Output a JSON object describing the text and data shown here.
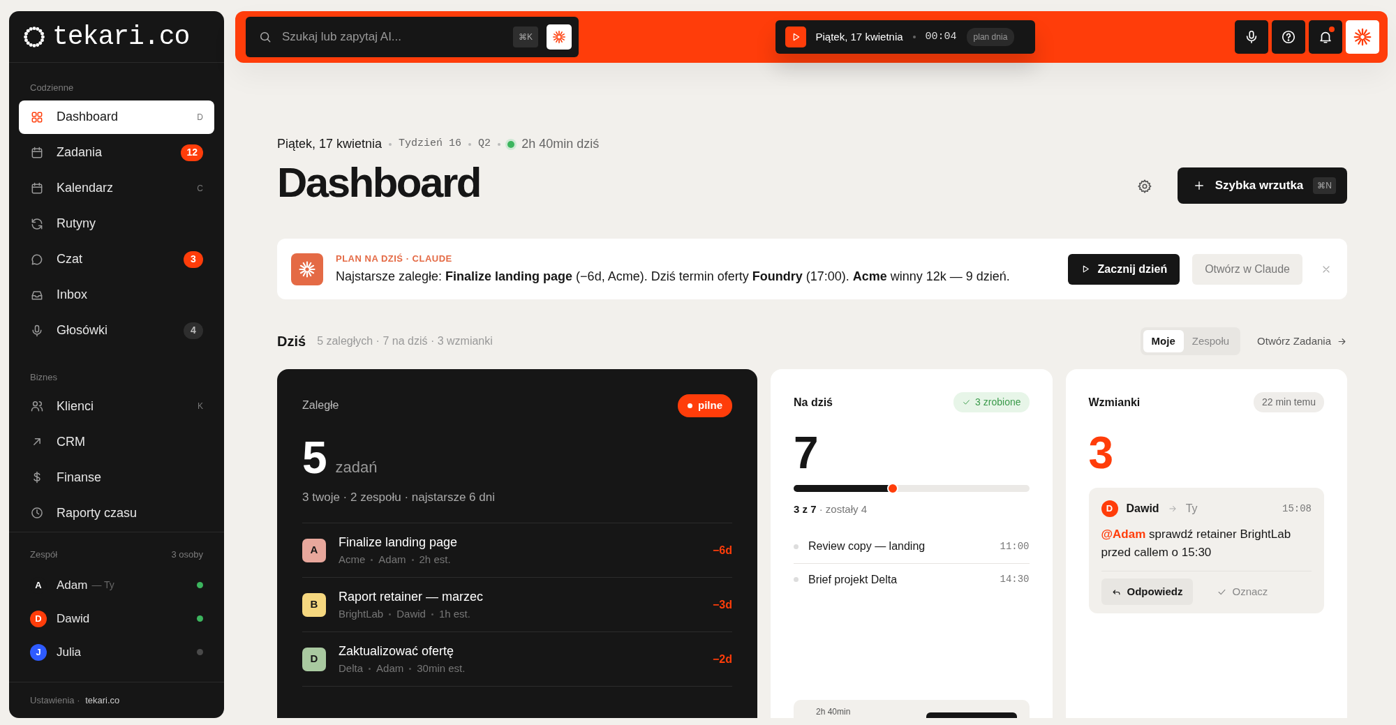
{
  "logo": {
    "text": "tekari.co"
  },
  "sidebar": {
    "sections": [
      {
        "title": "Codzienne",
        "items": [
          {
            "label": "Dashboard",
            "shortcut": "D",
            "selected": true
          },
          {
            "label": "Zadania",
            "badge": {
              "text": "12",
              "kind": "alert"
            },
            "selected": false
          },
          {
            "label": "Kalendarz",
            "shortcut": "C",
            "selected": false
          },
          {
            "label": "Rutyny",
            "selected": false
          },
          {
            "label": "Czat",
            "badge": {
              "text": "3",
              "kind": "alert"
            },
            "selected": false
          },
          {
            "label": "Inbox",
            "selected": false
          },
          {
            "label": "Głosówki",
            "badge": {
              "text": "4",
              "kind": "count"
            },
            "selected": false
          }
        ]
      },
      {
        "title": "Biznes",
        "items": [
          {
            "label": "Klienci",
            "shortcut": "K",
            "selected": false
          },
          {
            "label": "CRM",
            "selected": false
          },
          {
            "label": "Finanse",
            "selected": false
          },
          {
            "label": "Raporty czasu",
            "selected": false
          }
        ]
      }
    ],
    "team": {
      "title": "Zespół",
      "count": "3 osoby",
      "members": [
        {
          "initial": "A",
          "name": "Adam",
          "note": "— Ty",
          "color": "#161616",
          "online": true
        },
        {
          "initial": "D",
          "name": "Dawid",
          "color": "#ff3d0a",
          "online": true
        },
        {
          "initial": "J",
          "name": "Julia",
          "color": "#2e5bff",
          "online": false
        }
      ]
    },
    "footer": {
      "label": "Ustawienia ·",
      "link": "tekari.co"
    }
  },
  "topbar": {
    "search": {
      "placeholder": "Szukaj lub zapytaj AI...",
      "shortcut": "⌘K"
    },
    "session": {
      "date": "Piątek, 17 kwietnia",
      "timer": "00:04",
      "tag": "plan dnia"
    },
    "notifications": true
  },
  "header": {
    "date": "Piątek, 17 kwietnia",
    "meta": [
      "Tydzień 16",
      "Q2"
    ],
    "status": "2h 40min dziś",
    "title": "Dashboard",
    "quick_add": {
      "label": "Szybka wrzutka",
      "shortcut": "⌘N"
    }
  },
  "plan": {
    "label": "PLAN NA DZIŚ · CLAUDE",
    "text": "Najstarsze zaległe: **Finalize landing page** (−6d, Acme). Dziś termin oferty **Foundry** (17:00). **Acme** winny 12k — 9 dzień.",
    "buttons": [
      {
        "label": "Zacznij dzień",
        "kind": "primary"
      },
      {
        "label": "Otwórz w Claude",
        "kind": "secondary"
      }
    ]
  },
  "today": {
    "title": "Dziś",
    "summary": "5 zaległych · 7 na dziś · 3 wzmianki",
    "tabs": [
      {
        "label": "Moje",
        "selected": true
      },
      {
        "label": "Zespołu",
        "selected": false
      }
    ],
    "link": "Otwórz Zadania"
  },
  "overdue": {
    "title": "Zaległe",
    "badge": "pilne",
    "count": "5",
    "unit": "zadań",
    "summary": "3 twoje · 2 zespołu · najstarsze 6 dni",
    "tasks": [
      {
        "initial": "A",
        "color": "#e8a79c",
        "title": "Finalize landing page",
        "meta": [
          "Acme",
          "Adam",
          "2h est."
        ],
        "delay": "−6d"
      },
      {
        "initial": "B",
        "color": "#f5d77f",
        "title": "Raport retainer — marzec",
        "meta": [
          "BrightLab",
          "Dawid",
          "1h est."
        ],
        "delay": "−3d"
      },
      {
        "initial": "D",
        "color": "#a9c9a0",
        "title": "Zaktualizować ofertę",
        "meta": [
          "Delta",
          "Adam",
          "30min est."
        ],
        "delay": "−2d"
      }
    ]
  },
  "due_today": {
    "title": "Na dziś",
    "badge": "3 zrobione",
    "count": "7",
    "level": 0.42,
    "progress_text": "**3 z 7** · zostały 4",
    "items": [
      {
        "title": "Review copy — landing",
        "time": "11:00"
      },
      {
        "title": "Brief projekt Delta",
        "time": "14:30"
      }
    ],
    "footer": "2h 40min"
  },
  "mentions": {
    "title": "Wzmianki",
    "time": "22 min temu",
    "count": "3",
    "message": {
      "initial": "D",
      "from": "Dawid",
      "to": "Ty",
      "time": "15:08",
      "mention": "@Adam",
      "text": "sprawdź retainer BrightLab przed callem o 15:30",
      "actions": [
        {
          "label": "Odpowiedz",
          "kind": "primary"
        },
        {
          "label": "Oznacz",
          "kind": "secondary"
        }
      ]
    }
  }
}
